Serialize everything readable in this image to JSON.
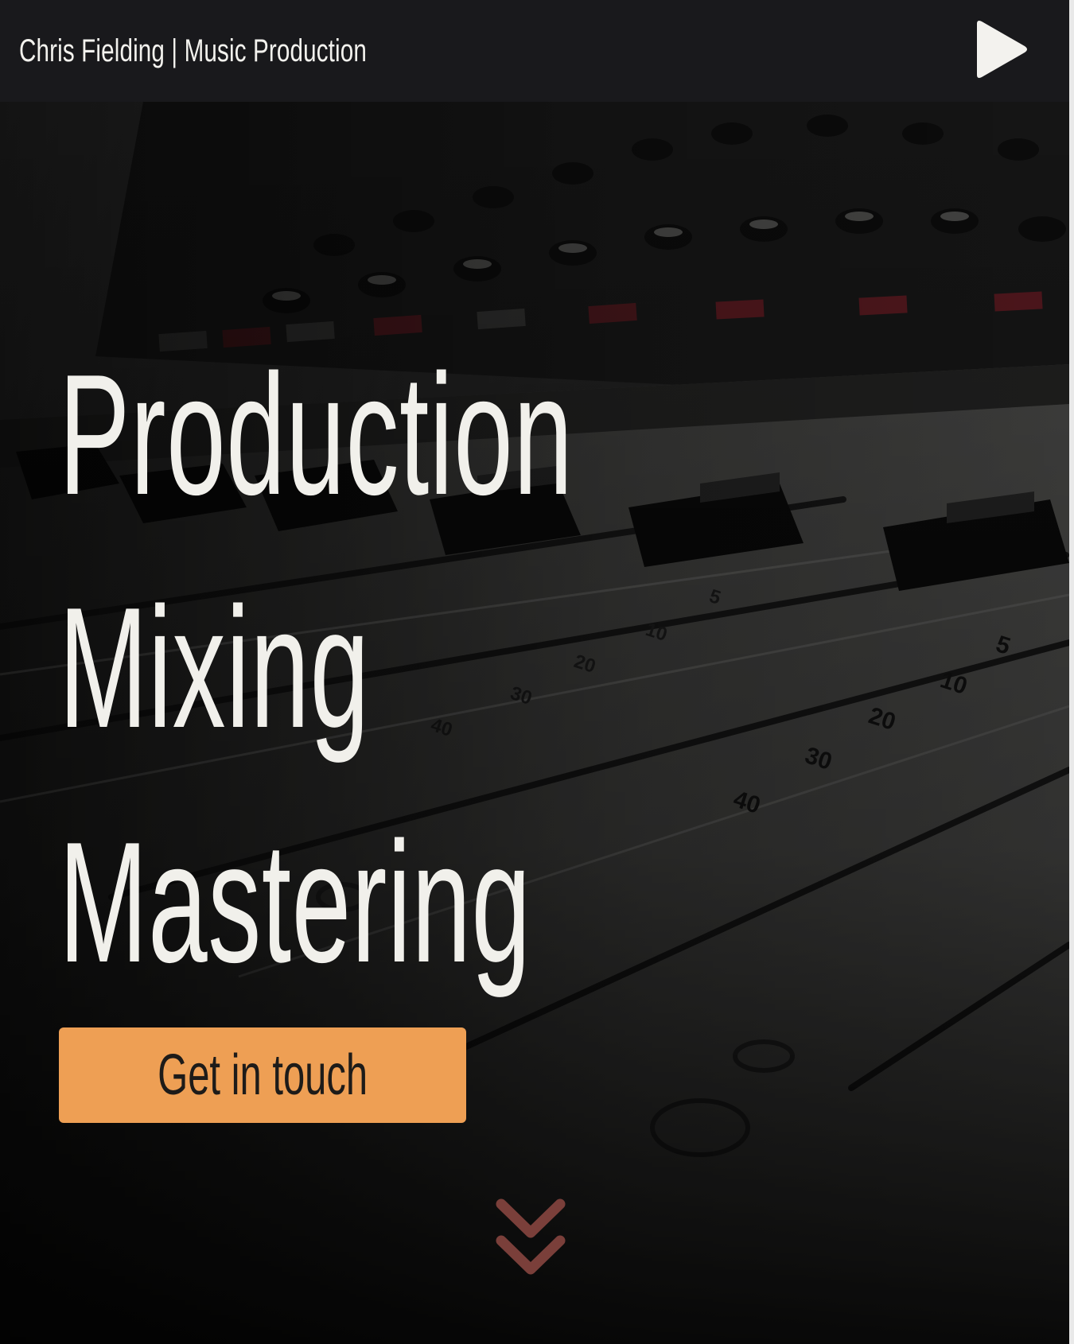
{
  "header": {
    "site_title": "Chris Fielding | Music Production",
    "play_icon": "play-icon"
  },
  "hero": {
    "headings": [
      "Production",
      "Mixing",
      "Mastering"
    ],
    "cta_label": "Get in touch",
    "scroll_icon": "double-chevron-down-icon",
    "background_image": "mixing-console-faders-photo",
    "fader_scale_labels": [
      "5",
      "10",
      "20",
      "30",
      "40"
    ]
  },
  "colors": {
    "header_bg": "#19191c",
    "heading_text": "#f1f0eb",
    "cta_bg": "#ee9f54",
    "cta_text": "#1d1b19",
    "scroll_icon": "#7a3f3a"
  }
}
